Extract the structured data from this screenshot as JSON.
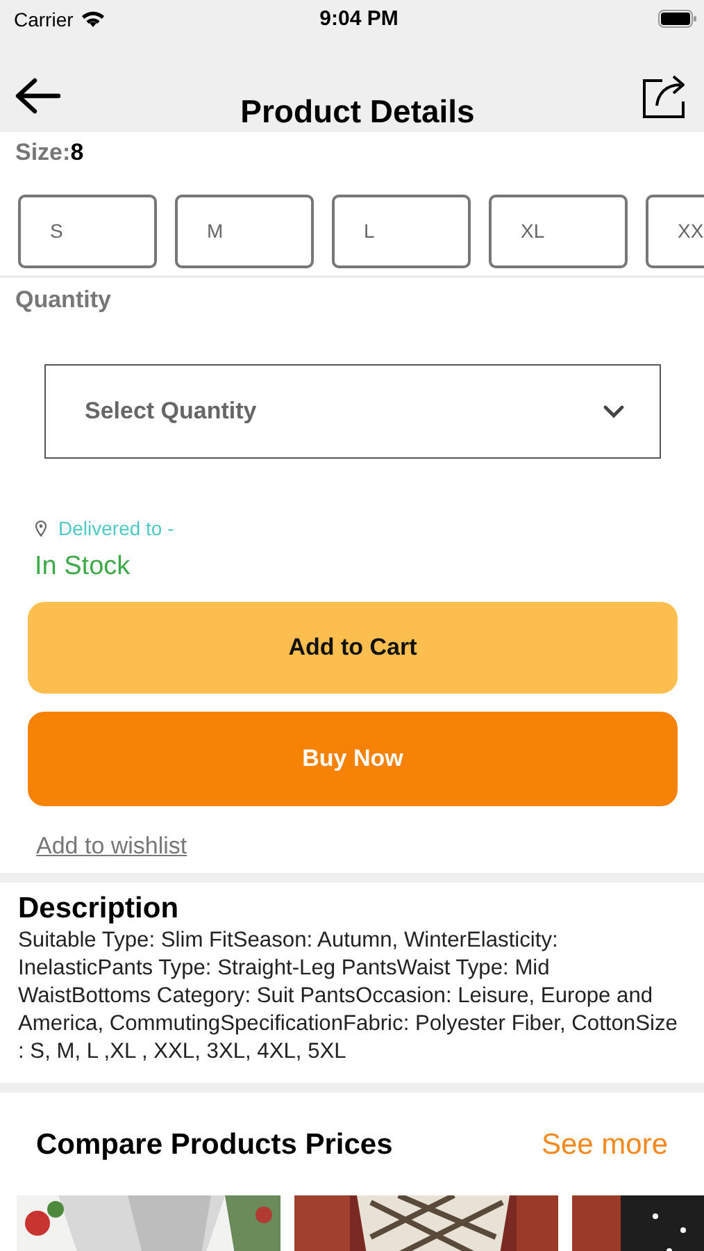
{
  "status_bar": {
    "carrier": "Carrier",
    "time": "9:04 PM"
  },
  "nav": {
    "title": "Product Details"
  },
  "size": {
    "label": "Size:",
    "value": "8",
    "options": [
      {
        "label": "S",
        "selected": false
      },
      {
        "label": "M",
        "selected": false
      },
      {
        "label": "L",
        "selected": false
      },
      {
        "label": "XL",
        "selected": false
      },
      {
        "label": "XX",
        "selected": false
      }
    ]
  },
  "quantity": {
    "label": "Quantity",
    "placeholder": "Select Quantity"
  },
  "delivery": {
    "label": "Delivered to -",
    "stock": "In Stock"
  },
  "buttons": [
    {
      "label": "Add to Cart",
      "kind": "secondary"
    },
    {
      "label": "Buy Now",
      "kind": "primary"
    }
  ],
  "wishlist": "Add to wishlist",
  "description": {
    "title": "Description",
    "text": "Suitable Type: Slim FitSeason: Autumn, WinterElasticity: InelasticPants Type: Straight-Leg PantsWaist Type: Mid WaistBottoms Category: Suit PantsOccasion: Leisure, Europe and America, CommutingSpecificationFabric: Polyester Fiber, CottonSize : S, M, L ,XL , XXL, 3XL, 4XL, 5XL"
  },
  "compare": {
    "title": "Compare Products Prices",
    "link": "See more"
  }
}
